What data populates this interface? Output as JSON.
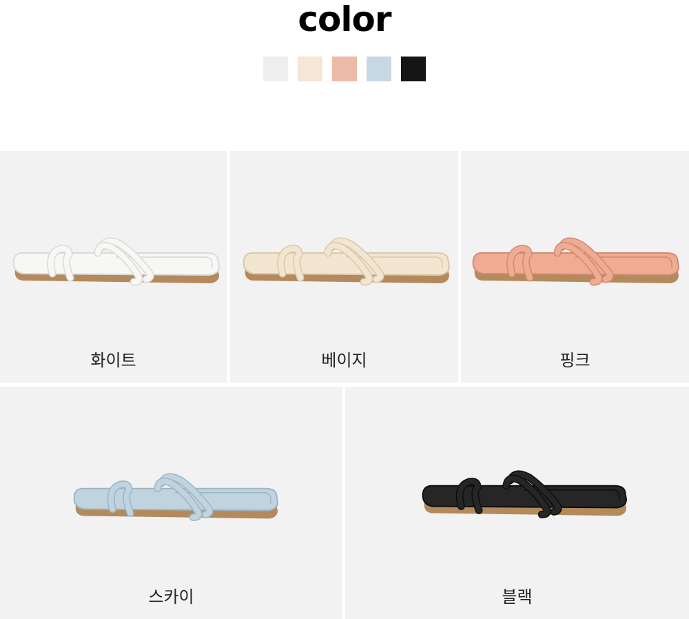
{
  "title": "color",
  "swatches": [
    {
      "name": "white-swatch",
      "color": "#eeeeee"
    },
    {
      "name": "beige-swatch",
      "color": "#f4e7d6"
    },
    {
      "name": "pink-swatch",
      "color": "#ecbaa6"
    },
    {
      "name": "sky-swatch",
      "color": "#c6d8e1"
    },
    {
      "name": "black-swatch",
      "color": "#151515"
    }
  ],
  "products": [
    {
      "label": "화이트",
      "color": "#f7f7f5",
      "shade": "#d9d9d6"
    },
    {
      "label": "베이지",
      "color": "#f2e6d1",
      "shade": "#d8c8ad"
    },
    {
      "label": "핑크",
      "color": "#efac93",
      "shade": "#cf8a72"
    },
    {
      "label": "스카이",
      "color": "#bfd4df",
      "shade": "#9db5c2"
    },
    {
      "label": "블랙",
      "color": "#262626",
      "shade": "#0d0d0d"
    }
  ]
}
